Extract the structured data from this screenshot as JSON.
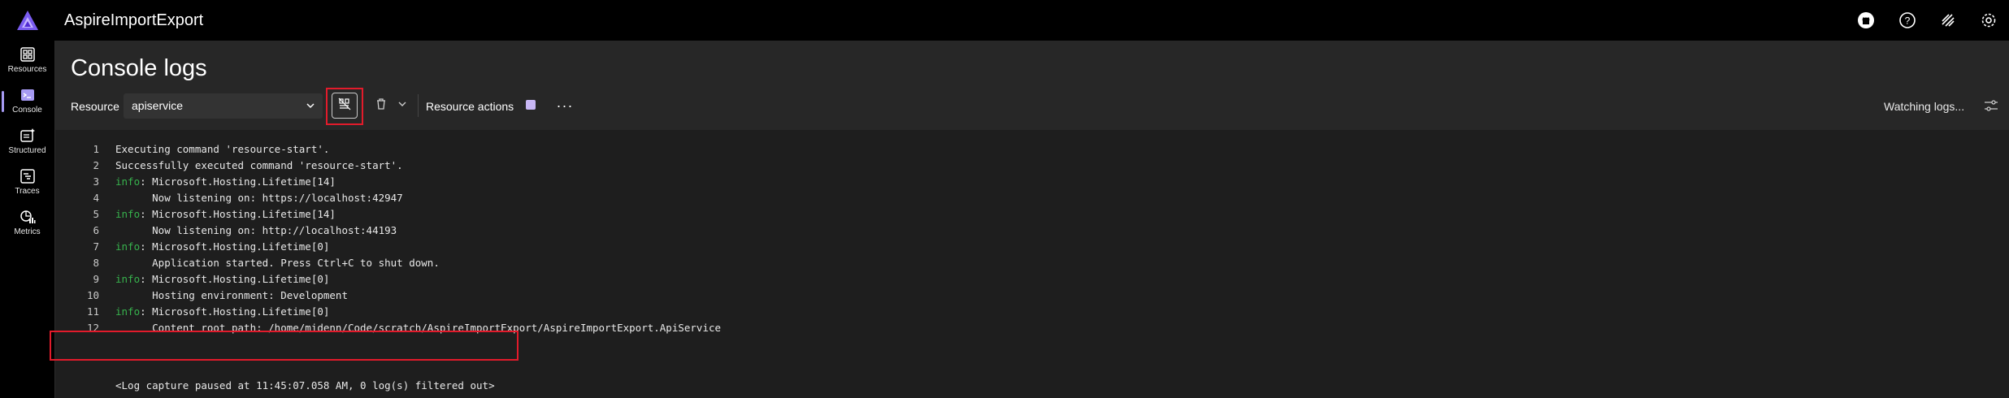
{
  "app": {
    "title": "AspireImportExport"
  },
  "topbar": {
    "icons": [
      "github-icon",
      "help-icon",
      "theme-icon",
      "settings-icon"
    ]
  },
  "nav": {
    "items": [
      {
        "label": "Resources",
        "icon": "resources-icon"
      },
      {
        "label": "Console",
        "icon": "console-icon",
        "active": true
      },
      {
        "label": "Structured",
        "icon": "structured-icon"
      },
      {
        "label": "Traces",
        "icon": "traces-icon"
      },
      {
        "label": "Metrics",
        "icon": "metrics-icon"
      }
    ]
  },
  "page": {
    "title": "Console logs"
  },
  "toolbar": {
    "resource_label": "Resource",
    "resource_value": "apiservice",
    "resource_actions_label": "Resource actions",
    "more_label": "···",
    "watching_label": "Watching logs..."
  },
  "logs": {
    "lines": [
      {
        "n": "1",
        "level": "",
        "text": "Executing command 'resource-start'."
      },
      {
        "n": "2",
        "level": "",
        "text": "Successfully executed command 'resource-start'."
      },
      {
        "n": "3",
        "level": "info",
        "text": ": Microsoft.Hosting.Lifetime[14]"
      },
      {
        "n": "4",
        "level": "",
        "text": "      Now listening on: https://localhost:42947"
      },
      {
        "n": "5",
        "level": "info",
        "text": ": Microsoft.Hosting.Lifetime[14]"
      },
      {
        "n": "6",
        "level": "",
        "text": "      Now listening on: http://localhost:44193"
      },
      {
        "n": "7",
        "level": "info",
        "text": ": Microsoft.Hosting.Lifetime[0]"
      },
      {
        "n": "8",
        "level": "",
        "text": "      Application started. Press Ctrl+C to shut down."
      },
      {
        "n": "9",
        "level": "info",
        "text": ": Microsoft.Hosting.Lifetime[0]"
      },
      {
        "n": "10",
        "level": "",
        "text": "      Hosting environment: Development"
      },
      {
        "n": "11",
        "level": "info",
        "text": ": Microsoft.Hosting.Lifetime[0]"
      },
      {
        "n": "12",
        "level": "",
        "text": "      Content root path: /home/midenn/Code/scratch/AspireImportExport/AspireImportExport.ApiService"
      }
    ],
    "pause_message": "<Log capture paused at 11:45:07.058 AM, 0 log(s) filtered out>"
  },
  "colors": {
    "accent": "#a79bf4",
    "info": "#37b24d",
    "highlight": "#e21b2b"
  }
}
